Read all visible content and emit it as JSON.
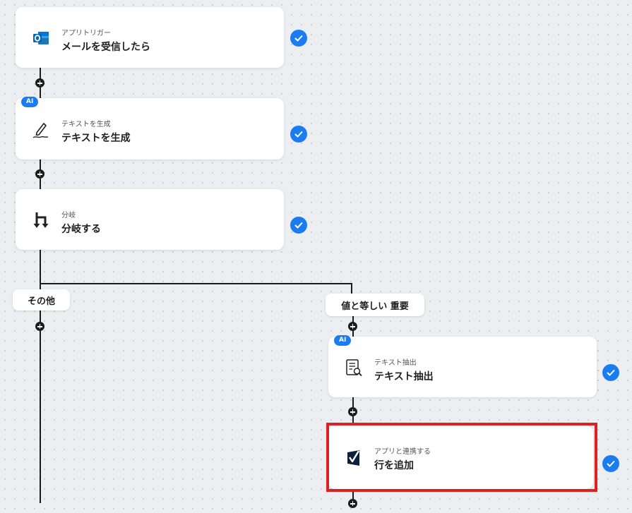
{
  "colors": {
    "accent": "#1a7cf0",
    "highlight": "#e02020",
    "line": "#1b1b1b"
  },
  "steps": [
    {
      "sub": "アプリトリガー",
      "title": "メールを受信したら",
      "icon": "outlook-icon",
      "ai": false,
      "completed": true
    },
    {
      "sub": "テキストを生成",
      "title": "テキストを生成",
      "icon": "pen-icon",
      "ai": true,
      "ai_label": "AI",
      "completed": true
    },
    {
      "sub": "分岐",
      "title": "分岐する",
      "icon": "branch-icon",
      "ai": false,
      "completed": true
    }
  ],
  "branches": {
    "left_label": "その他",
    "right_label": "値と等しい 重要"
  },
  "branch_steps": [
    {
      "sub": "テキスト抽出",
      "title": "テキスト抽出",
      "icon": "document-search-icon",
      "ai": true,
      "ai_label": "AI",
      "completed": true
    },
    {
      "sub": "アプリと連携する",
      "title": "行を追加",
      "icon": "smartsheet-icon",
      "ai": false,
      "completed": true,
      "highlighted": true
    }
  ]
}
